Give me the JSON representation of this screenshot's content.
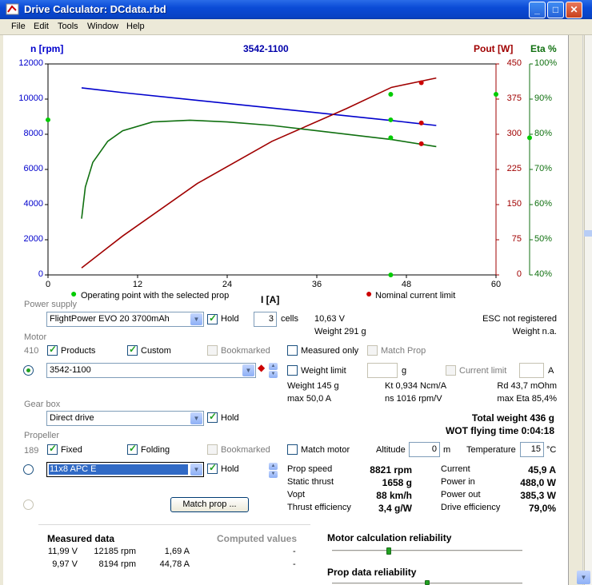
{
  "window": {
    "title": "Drive Calculator: DCdata.rbd"
  },
  "menu": [
    "File",
    "Edit",
    "Tools",
    "Window",
    "Help"
  ],
  "colors": {
    "blue": "#0000cc",
    "red": "#a00000",
    "green": "#107010",
    "titlebar": "#0a4bd6"
  },
  "chart": {
    "title": "3542-1100",
    "left_axis_label": "n [rpm]",
    "right_axis1_label": "Pout [W]",
    "right_axis2_label": "Eta %",
    "x_axis_label": "I [A]",
    "legend_op": "Operating point  with the selected prop",
    "legend_limit": "Nominal current limit",
    "y_rpm_ticks": [
      "12000",
      "10000",
      "8000",
      "6000",
      "4000",
      "2000",
      "0"
    ],
    "y_pout_ticks": [
      "450",
      "375",
      "300",
      "225",
      "150",
      "75",
      "0"
    ],
    "y_eta_ticks": [
      "100%",
      "90%",
      "80%",
      "70%",
      "60%",
      "50%",
      "40%"
    ],
    "x_ticks": [
      "0",
      "12",
      "24",
      "36",
      "48",
      "60"
    ]
  },
  "chart_data": {
    "type": "line",
    "title": "3542-1100",
    "xlabel": "I [A]",
    "xlim": [
      0,
      60
    ],
    "axes": {
      "rpm": {
        "label": "n [rpm]",
        "range": [
          0,
          12000
        ]
      },
      "pout": {
        "label": "Pout [W]",
        "range": [
          0,
          450
        ]
      },
      "eta": {
        "label": "Eta %",
        "range": [
          40,
          100
        ]
      }
    },
    "series": [
      {
        "axis": "rpm",
        "color": "#0000cc",
        "x": [
          4.5,
          10,
          20,
          30,
          40,
          46,
          52
        ],
        "y": [
          10640,
          10370,
          9930,
          9490,
          9050,
          8780,
          8500
        ]
      },
      {
        "axis": "pout",
        "color": "#a00000",
        "x": [
          4.5,
          10,
          20,
          30,
          40,
          46,
          52
        ],
        "y": [
          15,
          83,
          195,
          285,
          355,
          400,
          420
        ]
      },
      {
        "axis": "eta",
        "color": "#107010",
        "x": [
          4.5,
          5,
          6,
          8,
          10,
          14,
          19,
          24,
          30,
          36,
          42,
          46,
          52
        ],
        "y": [
          56,
          65,
          72,
          78,
          81,
          83.5,
          84,
          83.5,
          82.5,
          81,
          79.5,
          78.5,
          76.5
        ]
      }
    ],
    "operating_points": [
      {
        "x": 45.9,
        "rpm": 8821,
        "pout": 385.3,
        "eta": 79.0
      }
    ],
    "limit_points": [
      {
        "x": 50,
        "rpm": 8640,
        "pout": 410,
        "eta": 77.3
      }
    ]
  },
  "power_supply": {
    "label": "Power supply",
    "battery": "FlightPower EVO 20 3700mAh",
    "hold": "Hold",
    "cells_value": "3",
    "cells_label": "cells",
    "voltage": "10,63 V",
    "weight": "Weight 291 g",
    "esc": "ESC  not registered",
    "esc_weight": "Weight n.a."
  },
  "motor": {
    "label": "Motor",
    "count": "410",
    "products": "Products",
    "custom": "Custom",
    "bookmarked": "Bookmarked",
    "measured_only": "Measured only",
    "match_prop": "Match Prop",
    "selected": "3542-1100",
    "weight_limit": "Weight limit",
    "g_unit": "g",
    "current_limit": "Current limit",
    "a_unit": "A",
    "weight": "Weight 145 g",
    "kt": "Kt 0,934 Ncm/A",
    "rd": "Rd 43,7 mOhm",
    "max_current": "max 50,0 A",
    "ns": "ns 1016 rpm/V",
    "max_eta": "max Eta 85,4%"
  },
  "gearbox": {
    "label": "Gear box",
    "selected": "Direct drive",
    "hold": "Hold",
    "total_weight": "Total weight 436 g",
    "wot_time": "WOT flying time 0:04:18"
  },
  "propeller": {
    "label": "Propeller",
    "count": "189",
    "fixed": "Fixed",
    "folding": "Folding",
    "bookmarked": "Bookmarked",
    "match_motor": "Match motor",
    "altitude_label": "Altitude",
    "altitude_value": "0",
    "altitude_unit": "m",
    "temperature_label": "Temperature",
    "temperature_value": "15",
    "temperature_unit": "°C",
    "selected": "11x8 APC E",
    "hold": "Hold",
    "match_prop_button": "Match prop ..."
  },
  "results": {
    "prop_speed_label": "Prop speed",
    "prop_speed": "8821 rpm",
    "static_thrust_label": "Static thrust",
    "static_thrust": "1658 g",
    "vopt_label": "Vopt",
    "vopt": "88 km/h",
    "thrust_eff_label": "Thrust efficiency",
    "thrust_eff": "3,4 g/W",
    "current_label": "Current",
    "current": "45,9 A",
    "power_in_label": "Power in",
    "power_in": "488,0 W",
    "power_out_label": "Power out",
    "power_out": "385,3 W",
    "drive_eff_label": "Drive efficiency",
    "drive_eff": "79,0%"
  },
  "measured": {
    "title": "Measured data",
    "computed_title": "Computed values",
    "rows": [
      {
        "v": "11,99 V",
        "rpm": "12185 rpm",
        "a": "1,69 A",
        "c": "-"
      },
      {
        "v": "9,97 V",
        "rpm": "8194 rpm",
        "a": "44,78 A",
        "c": "-"
      }
    ]
  },
  "reliability": {
    "motor_title": "Motor calculation reliability",
    "motor_level": 0.3,
    "prop_title": "Prop data reliability",
    "prop_level": 0.5
  }
}
